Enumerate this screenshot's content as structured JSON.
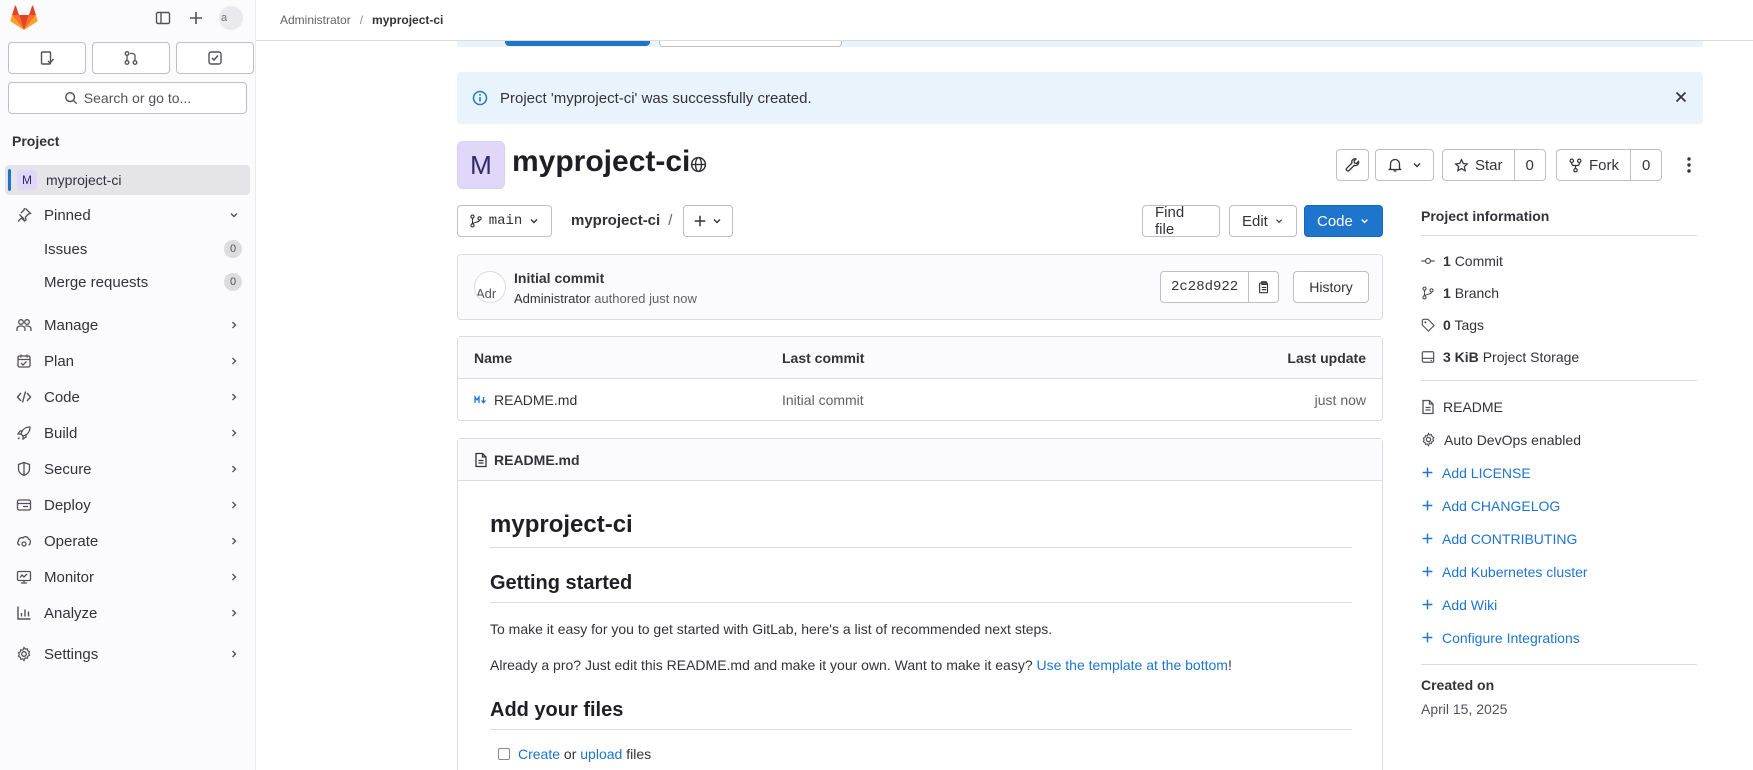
{
  "sidebar": {
    "avatar_alt": "a",
    "search_placeholder": "Search or go to...",
    "section_title": "Project",
    "project_name": "myproject-ci",
    "project_initial": "M",
    "pinned_label": "Pinned",
    "pinned_items": [
      {
        "label": "Issues",
        "count": "0"
      },
      {
        "label": "Merge requests",
        "count": "0"
      }
    ],
    "nav": [
      "Manage",
      "Plan",
      "Code",
      "Build",
      "Secure",
      "Deploy",
      "Operate",
      "Monitor",
      "Analyze",
      "Settings"
    ]
  },
  "breadcrumb": {
    "parent": "Administrator",
    "separator": "/",
    "current": "myproject-ci"
  },
  "alert": {
    "message": "Project 'myproject-ci' was successfully created."
  },
  "project": {
    "initial": "M",
    "name": "myproject-ci",
    "star_label": "Star",
    "star_count": "0",
    "fork_label": "Fork",
    "fork_count": "0"
  },
  "repo": {
    "branch": "main",
    "path": "myproject-ci",
    "path_sep": "/",
    "find_file": "Find file",
    "edit": "Edit",
    "code": "Code"
  },
  "commit": {
    "avatar_alt": "Adr",
    "title": "Initial commit",
    "author": "Administrator",
    "meta_suffix": "authored just now",
    "sha": "2c28d922",
    "history": "History"
  },
  "files": {
    "headers": {
      "name": "Name",
      "last_commit": "Last commit",
      "last_update": "Last update"
    },
    "rows": [
      {
        "name": "README.md",
        "last_commit": "Initial commit",
        "last_update": "just now"
      }
    ]
  },
  "readme": {
    "filename": "README.md",
    "h1": "myproject-ci",
    "h2_getting_started": "Getting started",
    "p1": "To make it easy for you to get started with GitLab, here's a list of recommended next steps.",
    "p2_prefix": "Already a pro? Just edit this README.md and make it your own. Want to make it easy? ",
    "p2_link": "Use the template at the bottom",
    "p2_suffix": "!",
    "h2_add_files": "Add your files",
    "todo_create": "Create",
    "todo_or": " or ",
    "todo_upload": "upload",
    "todo_files": " files"
  },
  "info": {
    "title": "Project information",
    "commits_num": "1",
    "commits_label": "Commit",
    "branches_num": "1",
    "branches_label": "Branch",
    "tags_num": "0",
    "tags_label": "Tags",
    "storage_num": "3 KiB",
    "storage_label": "Project Storage",
    "readme": "README",
    "autodevops": "Auto DevOps enabled",
    "add_links": [
      "Add LICENSE",
      "Add CHANGELOG",
      "Add CONTRIBUTING",
      "Add Kubernetes cluster",
      "Add Wiki",
      "Configure Integrations"
    ],
    "created_label": "Created on",
    "created_date": "April 15, 2025"
  },
  "colors": {
    "accent": "#1f75cb",
    "alert_bg": "#e9f3fc",
    "avatar_bg": "#e1d8f9",
    "sidebar_bg": "#fbfafd",
    "gitlab_orange": "#fc6d26"
  }
}
